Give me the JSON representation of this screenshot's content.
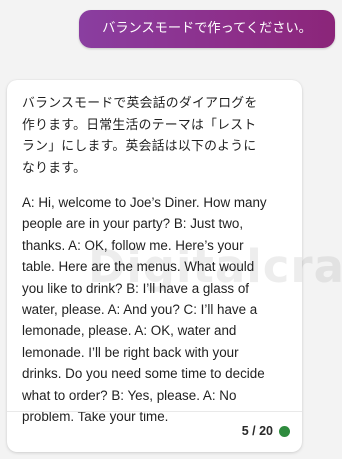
{
  "user_message": {
    "text": "バランスモードで作ってください。"
  },
  "assistant_message": {
    "intro": "バランスモードで英会話のダイアログを\n作ります。日常生活のテーマは「レスト\nラン」にします。英会話は以下のように\nなります。",
    "dialogue": "A: Hi, welcome to Joe’s Diner. How many\npeople are in your party? B: Just two,\nthanks. A: OK, follow me. Here’s your\ntable. Here are the menus. What would\nyou like to drink? B: I’ll have a glass of\nwater, please. A: And you? C: I’ll have a\nlemonade, please. A: OK, water and\nlemonade. I’ll be right back with your\ndrinks. Do you need some time to decide\nwhat to order? B: Yes, please. A: No\nproblem. Take your time."
  },
  "turn_counter": {
    "text": "5 / 20",
    "dot_color": "#2e8b3e",
    "dot_icon": "status-dot-icon"
  },
  "watermark": {
    "text": "Digitalcraze"
  },
  "colors": {
    "user_bubble_start": "#8a3ea0",
    "user_bubble_end": "#8b2579",
    "background": "#f3f3f3",
    "card": "#ffffff"
  }
}
